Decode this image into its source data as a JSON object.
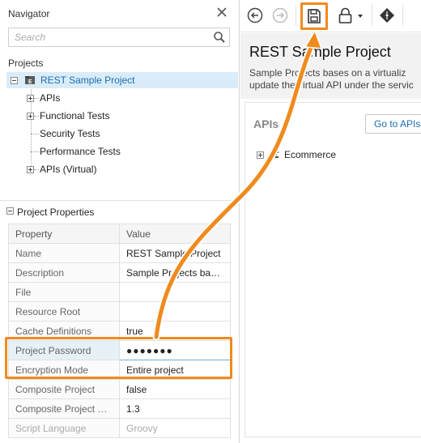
{
  "navigator": {
    "title": "Navigator",
    "search_placeholder": "Search",
    "projects_label": "Projects",
    "tree": {
      "root": "REST Sample Project",
      "children": [
        "APIs",
        "Functional Tests",
        "Security Tests",
        "Performance Tests",
        "APIs (Virtual)"
      ]
    }
  },
  "properties": {
    "title": "Project Properties",
    "columns": [
      "Property",
      "Value"
    ],
    "rows": [
      {
        "name": "Name",
        "value": "REST Sample Project"
      },
      {
        "name": "Description",
        "value": "Sample Projects bases..."
      },
      {
        "name": "File",
        "value": ""
      },
      {
        "name": "Resource Root",
        "value": ""
      },
      {
        "name": "Cache Definitions",
        "value": "true"
      },
      {
        "name": "Project Password",
        "value": "●●●●●●●"
      },
      {
        "name": "Encryption Mode",
        "value": "Entire project"
      },
      {
        "name": "Composite Project",
        "value": "false"
      },
      {
        "name": "Composite Project For...",
        "value": "1.3"
      },
      {
        "name": "Script Language",
        "value": "Groovy"
      }
    ]
  },
  "toolbar": {
    "icons": [
      "back-arrow-icon",
      "forward-arrow-icon",
      "save-icon",
      "lock-icon",
      "dropdown-caret-icon",
      "diamond-icon"
    ]
  },
  "main": {
    "title": "REST Sample Project",
    "description_line1": "Sample Projects bases on a virtualiz",
    "description_line2": "update the virtual API under the servic",
    "apis_title": "APIs",
    "goto_button": "Go to APIs",
    "api_items": [
      "Ecommerce"
    ]
  },
  "colors": {
    "highlight": "#f08a1e",
    "link_blue": "#1b6eb0",
    "selection": "#d9ecf8"
  }
}
